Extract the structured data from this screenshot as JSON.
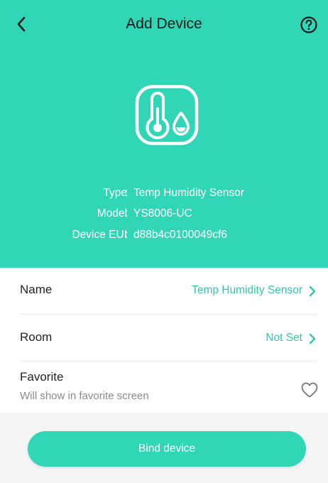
{
  "header": {
    "title": "Add Device",
    "back_icon": "chevron-left-icon",
    "help_icon": "question-circle-icon"
  },
  "device": {
    "icon": "thermometer-droplet-icon",
    "info": [
      {
        "label": "Type",
        "value": "Temp Humidity Sensor"
      },
      {
        "label": "Model",
        "value": "YS8006-UC"
      },
      {
        "label": "Device EUI",
        "value": "d88b4c0100049cf6"
      }
    ]
  },
  "settings": {
    "name": {
      "label": "Name",
      "value": "Temp Humidity Sensor"
    },
    "room": {
      "label": "Room",
      "value": "Not Set"
    },
    "favorite": {
      "label": "Favorite",
      "sublabel": "Will show in favorite screen",
      "icon": "heart-outline-icon"
    }
  },
  "actions": {
    "bind_label": "Bind device"
  },
  "colors": {
    "accent": "#31d6b7",
    "accent_text": "#31c7ab",
    "title_text": "#1b1b1b"
  }
}
